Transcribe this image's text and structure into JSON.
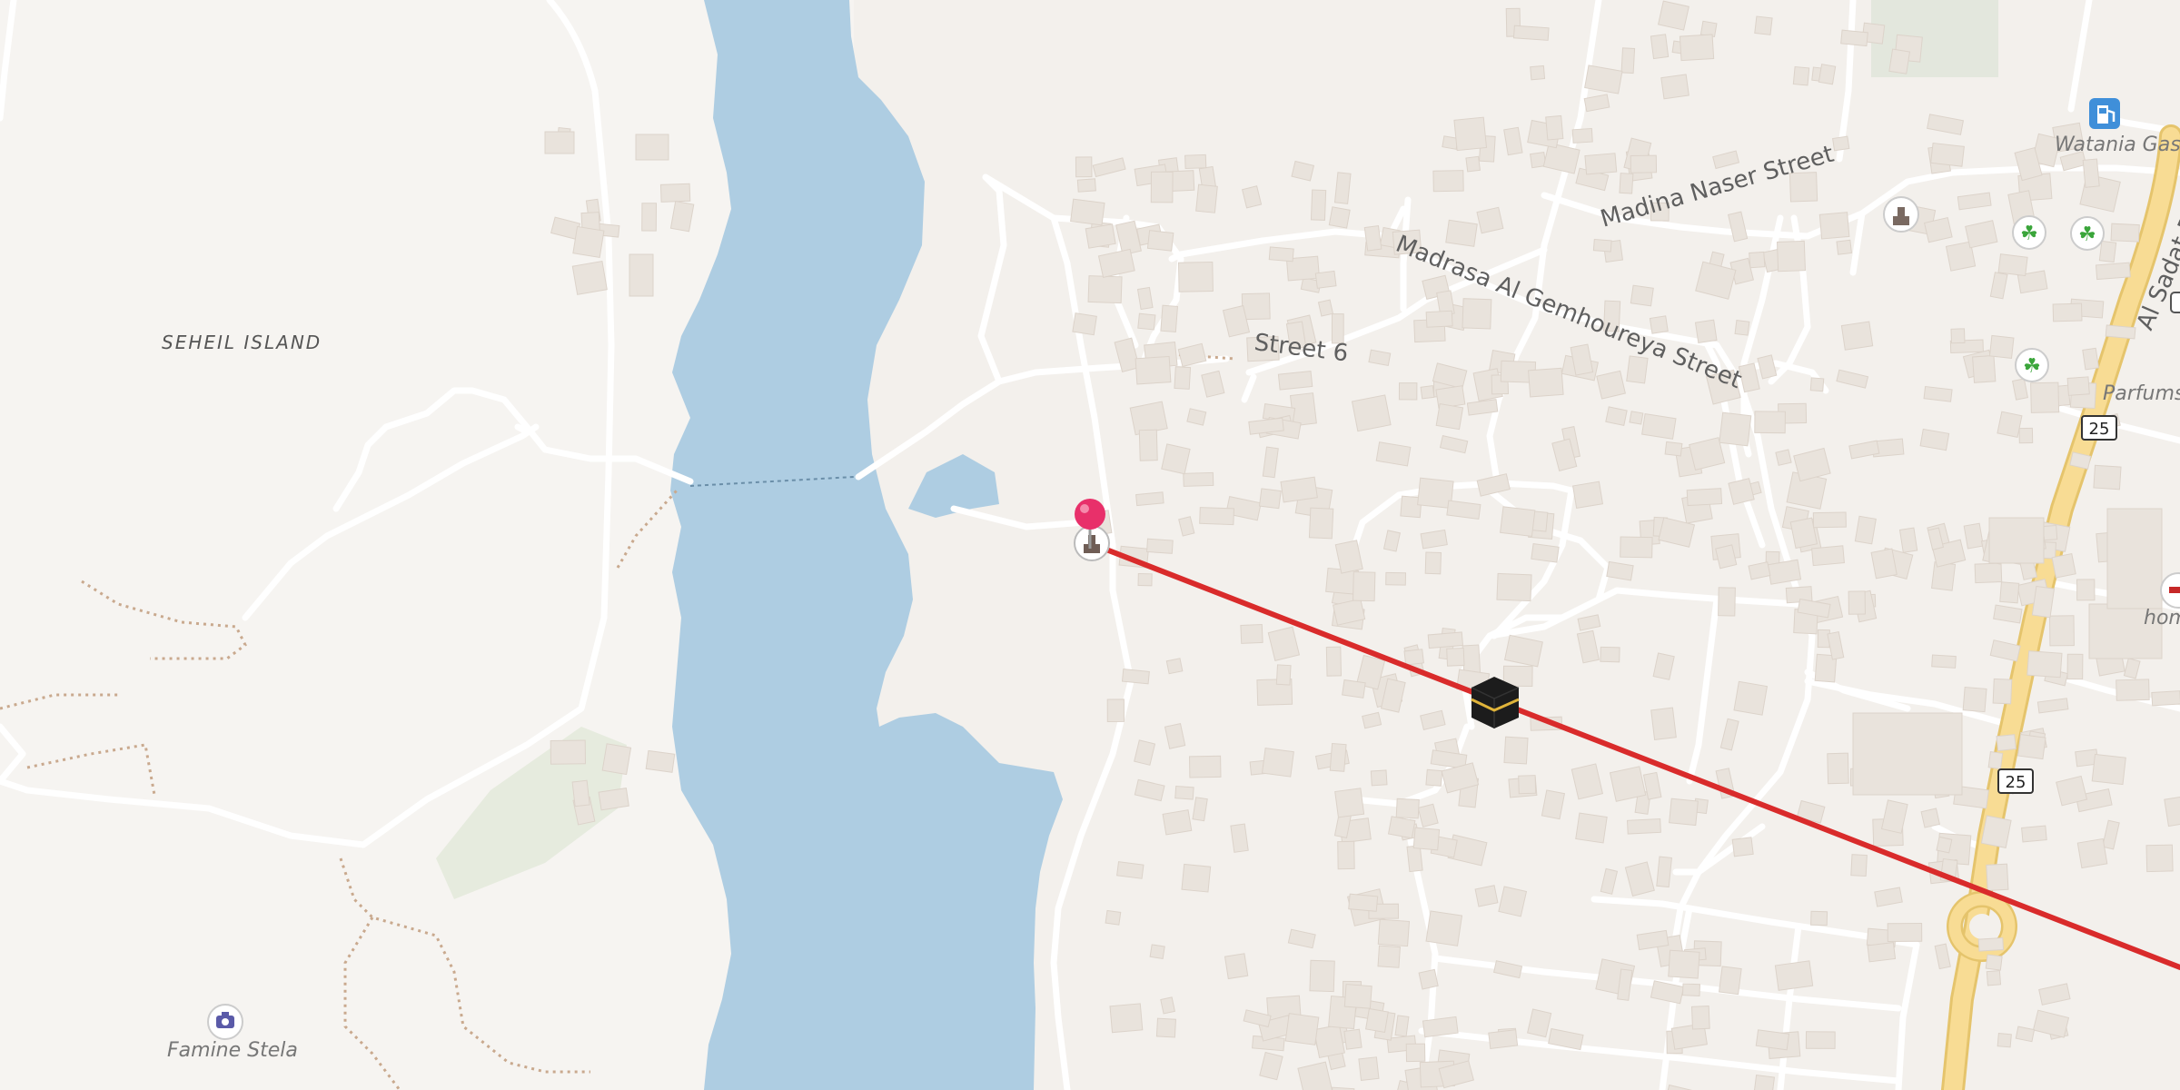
{
  "map": {
    "area_labels": {
      "seheil_island": "SEHEIL ISLAND"
    },
    "streets": {
      "madina_naser": "Madina Naser Street",
      "madrasa": "Madrasa Al Gemhoureya Street",
      "street6": "Street 6",
      "al_sadat": "Al Sadat Road"
    },
    "pois": {
      "watania_gas": "Watania Gas",
      "famine_stela": "Famine Stela",
      "parfums": "Parfums",
      "hom": "hom"
    },
    "route_shields": [
      "25",
      "25"
    ],
    "colors": {
      "water": "#aecde2",
      "land": "#f6f4f1",
      "road_major": "#f7d98c",
      "route_line": "#d92b2b",
      "pin": "#e8306a",
      "park": "#e6ebde"
    },
    "icons": {
      "pin": "map-pin-icon",
      "kaaba": "kaaba-icon",
      "fuel": "fuel-station-icon",
      "camera": "camera-icon",
      "monument": "monument-icon",
      "sport": "running-icon"
    }
  }
}
